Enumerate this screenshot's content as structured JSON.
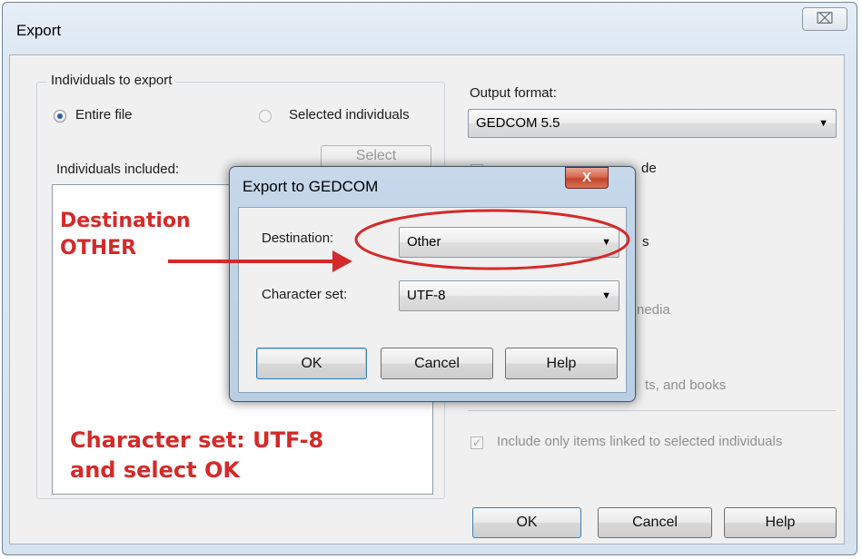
{
  "export_window": {
    "title": "Export",
    "close_glyph": "⌧",
    "individuals_group": {
      "label": "Individuals to export",
      "entire_file": "Entire file",
      "selected_individuals": "Selected individuals",
      "select_button": "Select",
      "included_label": "Individuals included:"
    },
    "output_format": {
      "label": "Output format:",
      "value": "GEDCOM 5.5"
    },
    "partial_labels": {
      "row1_tail": "de",
      "row3_tail": "s",
      "row5_tail": "nedia",
      "row7_tail": "ts, and books"
    },
    "include_only_linked": "Include only items linked  to selected individuals",
    "buttons": {
      "ok": "OK",
      "cancel": "Cancel",
      "help": "Help"
    }
  },
  "gedcom_dialog": {
    "title": "Export to GEDCOM",
    "close_glyph": "X",
    "destination_label": "Destination:",
    "destination_value": "Other",
    "charset_label": "Character set:",
    "charset_value": "UTF-8",
    "buttons": {
      "ok": "OK",
      "cancel": "Cancel",
      "help": "Help"
    }
  },
  "annotations": {
    "dest_line1": "Destination",
    "dest_line2": "OTHER",
    "charset_line1": "Character set: UTF-8",
    "charset_line2": "and select OK",
    "color": "#d42a2a"
  }
}
